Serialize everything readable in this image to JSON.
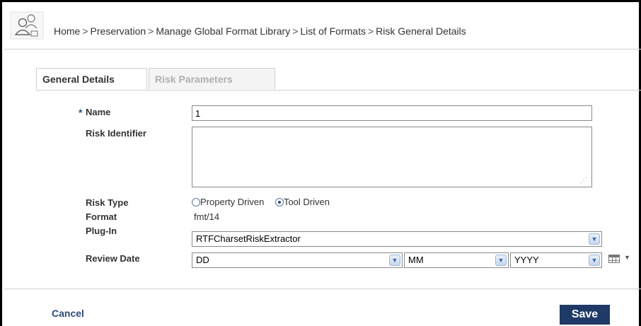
{
  "breadcrumb": {
    "items": [
      "Home",
      "Preservation",
      "Manage Global Format Library",
      "List of Formats"
    ],
    "separator": ">",
    "current": "Risk General Details"
  },
  "tabs": [
    {
      "label": "General Details",
      "active": true
    },
    {
      "label": "Risk Parameters",
      "active": false
    }
  ],
  "form": {
    "required_marker": "*",
    "name": {
      "label": "Name",
      "value": "1"
    },
    "risk_identifier": {
      "label": "Risk Identifier",
      "value": ""
    },
    "risk_type": {
      "label": "Risk Type",
      "options": [
        {
          "label": "Property Driven",
          "selected": false
        },
        {
          "label": "Tool Driven",
          "selected": true
        }
      ]
    },
    "format": {
      "label": "Format",
      "value": "fmt/14"
    },
    "plugin": {
      "label": "Plug-In",
      "value": "RTFCharsetRiskExtractor"
    },
    "review_date": {
      "label": "Review Date",
      "day": "DD",
      "month": "MM",
      "year": "YYYY"
    }
  },
  "icons": {
    "logo": "users-group-icon",
    "dropdown": "chevron-down-icon",
    "calendar": "calendar-icon"
  },
  "actions": {
    "cancel_label": "Cancel",
    "save_label": "Save"
  },
  "colors": {
    "primary_button": "#1f3a66",
    "link": "#2f4a78",
    "required": "#2f4f8f"
  }
}
